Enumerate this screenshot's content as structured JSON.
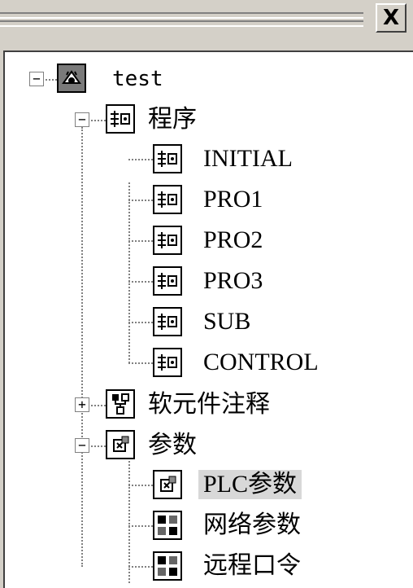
{
  "window": {
    "close_glyph": "X"
  },
  "tree": {
    "root": {
      "label": "test",
      "expander": "−",
      "icon": "project-icon"
    },
    "program": {
      "label": "程序",
      "expander": "−",
      "icon": "program-folder-icon",
      "children": [
        "INITIAL",
        "PRO1",
        "PRO2",
        "PRO3",
        "SUB",
        "CONTROL"
      ]
    },
    "device_comment": {
      "label": "软元件注释",
      "expander": "+",
      "icon": "device-comment-icon"
    },
    "parameters": {
      "label": "参数",
      "expander": "−",
      "icon": "parameter-folder-icon",
      "children": [
        "PLC参数",
        "网络参数",
        "远程口令"
      ],
      "selected": "PLC参数"
    }
  }
}
